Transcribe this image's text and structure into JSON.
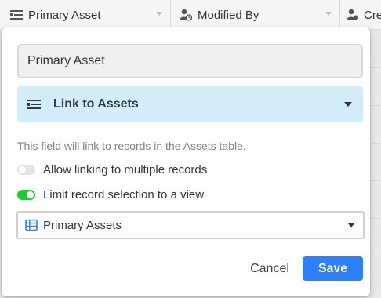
{
  "header": {
    "columns": [
      {
        "label": "Primary Asset",
        "icon": "link-list-icon"
      },
      {
        "label": "Modified By",
        "icon": "user-clock-icon"
      },
      {
        "label": "Cre",
        "icon": "user-icon"
      }
    ]
  },
  "dialog": {
    "field_name": "Primary Asset",
    "field_type": {
      "label": "Link to Assets",
      "icon": "link-list-icon",
      "bg": "#d3ecfa"
    },
    "description": "This field will link to records in the Assets table.",
    "options": [
      {
        "label": "Allow linking to multiple records",
        "enabled": false
      },
      {
        "label": "Limit record selection to a view",
        "enabled": true
      }
    ],
    "view_select": {
      "label": "Primary Assets",
      "icon": "grid-view-icon",
      "icon_color": "#2d7ff9"
    },
    "cancel_label": "Cancel",
    "save_label": "Save"
  },
  "colors": {
    "accent": "#2d7ff9",
    "toggle_on": "#20c933",
    "toggle_off": "#e3e3e3"
  }
}
